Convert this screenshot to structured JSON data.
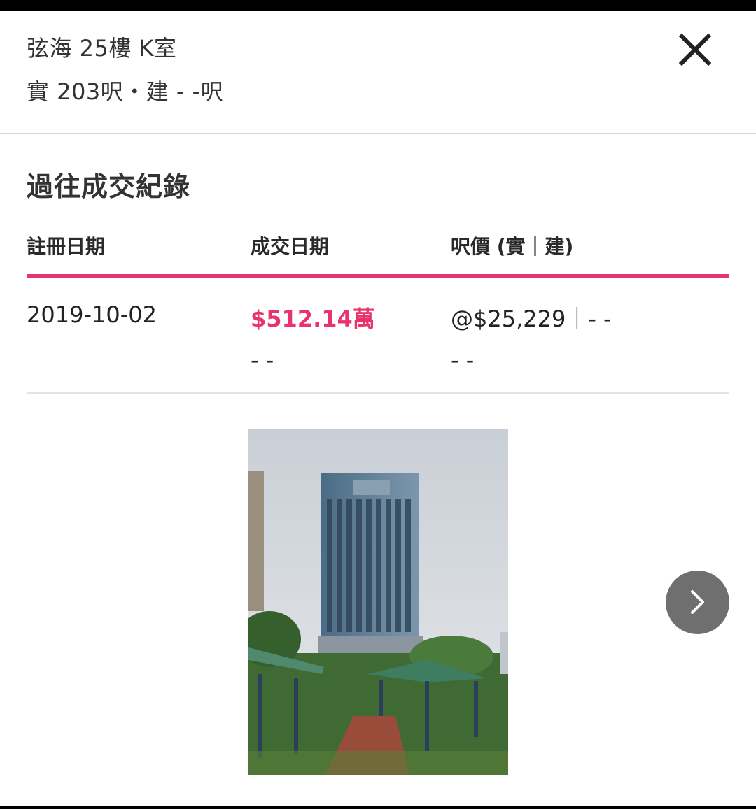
{
  "header": {
    "title": "弦海 25樓 K室",
    "subtitle": "實 203呎・建 - -呎",
    "close_icon": "close-icon"
  },
  "section": {
    "title": "過往成交紀錄"
  },
  "table": {
    "columns": [
      "註冊日期",
      "成交日期",
      "呎價 (實｜建)"
    ],
    "rows": [
      {
        "registration_date": "2019-10-02",
        "price": "$512.14萬",
        "price_per_sqft": "@$25,229｜- -",
        "price_secondary": "- -",
        "ppsf_secondary": "- -"
      }
    ],
    "accent_color": "#e8336b"
  },
  "gallery": {
    "image_subject": "residential-tower-photo",
    "next_icon": "chevron-right-icon"
  }
}
